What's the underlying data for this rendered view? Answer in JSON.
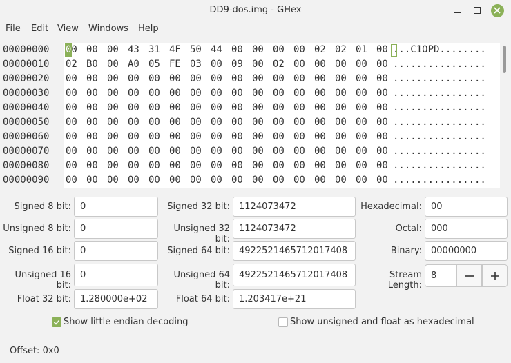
{
  "window": {
    "title": "DD9-dos.img - GHex"
  },
  "menu": [
    "File",
    "Edit",
    "View",
    "Windows",
    "Help"
  ],
  "hex": {
    "rows": [
      {
        "offset": "00000000",
        "bytes": [
          "00",
          "00",
          "00",
          "43",
          "31",
          "4F",
          "50",
          "44",
          "00",
          "00",
          "00",
          "00",
          "02",
          "02",
          "01",
          "00"
        ],
        "ascii": "...C1OPD........"
      },
      {
        "offset": "00000010",
        "bytes": [
          "02",
          "B0",
          "00",
          "A0",
          "05",
          "FE",
          "03",
          "00",
          "09",
          "00",
          "02",
          "00",
          "00",
          "00",
          "00",
          "00"
        ],
        "ascii": "................"
      },
      {
        "offset": "00000020",
        "bytes": [
          "00",
          "00",
          "00",
          "00",
          "00",
          "00",
          "00",
          "00",
          "00",
          "00",
          "00",
          "00",
          "00",
          "00",
          "00",
          "00"
        ],
        "ascii": "................"
      },
      {
        "offset": "00000030",
        "bytes": [
          "00",
          "00",
          "00",
          "00",
          "00",
          "00",
          "00",
          "00",
          "00",
          "00",
          "00",
          "00",
          "00",
          "00",
          "00",
          "00"
        ],
        "ascii": "................"
      },
      {
        "offset": "00000040",
        "bytes": [
          "00",
          "00",
          "00",
          "00",
          "00",
          "00",
          "00",
          "00",
          "00",
          "00",
          "00",
          "00",
          "00",
          "00",
          "00",
          "00"
        ],
        "ascii": "................"
      },
      {
        "offset": "00000050",
        "bytes": [
          "00",
          "00",
          "00",
          "00",
          "00",
          "00",
          "00",
          "00",
          "00",
          "00",
          "00",
          "00",
          "00",
          "00",
          "00",
          "00"
        ],
        "ascii": "................"
      },
      {
        "offset": "00000060",
        "bytes": [
          "00",
          "00",
          "00",
          "00",
          "00",
          "00",
          "00",
          "00",
          "00",
          "00",
          "00",
          "00",
          "00",
          "00",
          "00",
          "00"
        ],
        "ascii": "................"
      },
      {
        "offset": "00000070",
        "bytes": [
          "00",
          "00",
          "00",
          "00",
          "00",
          "00",
          "00",
          "00",
          "00",
          "00",
          "00",
          "00",
          "00",
          "00",
          "00",
          "00"
        ],
        "ascii": "................"
      },
      {
        "offset": "00000080",
        "bytes": [
          "00",
          "00",
          "00",
          "00",
          "00",
          "00",
          "00",
          "00",
          "00",
          "00",
          "00",
          "00",
          "00",
          "00",
          "00",
          "00"
        ],
        "ascii": "................"
      },
      {
        "offset": "00000090",
        "bytes": [
          "00",
          "00",
          "00",
          "00",
          "00",
          "00",
          "00",
          "00",
          "00",
          "00",
          "00",
          "00",
          "00",
          "00",
          "00",
          "00"
        ],
        "ascii": "................"
      }
    ]
  },
  "converter": {
    "signed8_label": "Signed 8 bit:",
    "signed8_value": "0",
    "unsigned8_label": "Unsigned 8 bit:",
    "unsigned8_value": "0",
    "signed16_label": "Signed 16 bit:",
    "signed16_value": "0",
    "unsigned16_label": "Unsigned 16 bit:",
    "unsigned16_value": "0",
    "float32_label": "Float 32 bit:",
    "float32_value": "1.280000e+02",
    "signed32_label": "Signed 32 bit:",
    "signed32_value": "1124073472",
    "unsigned32_label": "Unsigned 32 bit:",
    "unsigned32_value": "1124073472",
    "signed64_label": "Signed 64 bit:",
    "signed64_value": "4922521465712017408",
    "unsigned64_label": "Unsigned 64 bit:",
    "unsigned64_value": "4922521465712017408",
    "float64_label": "Float 64 bit:",
    "float64_value": "1.203417e+21",
    "hex_label": "Hexadecimal:",
    "hex_value": "00",
    "octal_label": "Octal:",
    "octal_value": "000",
    "binary_label": "Binary:",
    "binary_value": "00000000",
    "stream_label": "Stream Length:",
    "stream_value": "8",
    "little_endian_label": "Show little endian decoding",
    "little_endian_checked": true,
    "unsigned_hex_label": "Show unsigned and float as hexadecimal",
    "unsigned_hex_checked": false
  },
  "status": {
    "offset": "Offset: 0x0"
  },
  "colors": {
    "accent": "#8bb158"
  }
}
